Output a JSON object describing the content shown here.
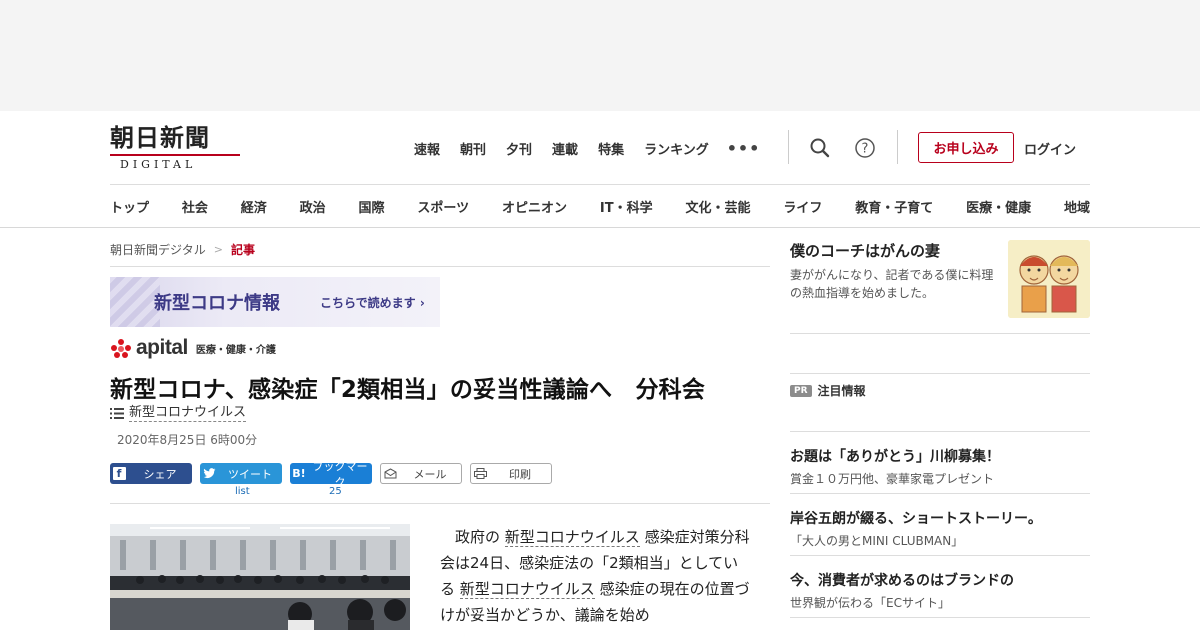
{
  "header": {
    "logo_main": "朝日新聞",
    "logo_sub": "DIGITAL",
    "top_nav": [
      "速報",
      "朝刊",
      "夕刊",
      "連載",
      "特集",
      "ランキング"
    ],
    "more_label": "•••",
    "subscribe_label": "お申し込み",
    "login_label": "ログイン",
    "help_label": "?"
  },
  "category_nav": [
    "トップ",
    "社会",
    "経済",
    "政治",
    "国際",
    "スポーツ",
    "オピニオン",
    "IT・科学",
    "文化・芸能",
    "ライフ",
    "教育・子育て",
    "医療・健康",
    "地域"
  ],
  "breadcrumb": {
    "home": "朝日新聞デジタル",
    "separator": ">",
    "current": "記事"
  },
  "banner": {
    "title": "新型コロナ情報",
    "link": "こちらで読めます ›"
  },
  "apital": {
    "word": "apital",
    "tagline": "医療・健康・介護"
  },
  "article": {
    "title": "新型コロナ、感染症「2類相当」の妥当性議論へ　分科会",
    "topic": "新型コロナウイルス",
    "date": "2020年8月25日 6時00分",
    "body": {
      "p1_a": "　政府の",
      "kw1": "新型コロナウイルス",
      "p1_b": "感染症対策分科会は24日、感染症法の「2類相当」としている",
      "kw2": "新型コロナウイルス",
      "p1_c": "感染症の現在の位置づけが妥当かどうか、議論を始め"
    }
  },
  "share": {
    "facebook": {
      "icon": "f",
      "label": "シェア"
    },
    "twitter": {
      "icon": "t",
      "label": "ツイート",
      "count": "list"
    },
    "hatena": {
      "icon": "B!",
      "label": "ブックマーク",
      "count": "25"
    },
    "mail": {
      "label": "メール"
    },
    "print": {
      "label": "印刷"
    }
  },
  "sidebar": {
    "feature": {
      "title": "僕のコーチはがんの妻",
      "desc": "妻ががんになり、記者である僕に料理の熱血指導を始めました。"
    },
    "pr_badge": "PR",
    "pr_title": "注目情報",
    "pr_items": [
      {
        "title": "お題は「ありがとう」川柳募集！",
        "desc": "賞金１０万円他、豪華家電プレゼント"
      },
      {
        "title": "岸谷五朗が綴る、ショートストーリー。",
        "desc": "「大人の男とMINI CLUBMAN」"
      },
      {
        "title": "今、消費者が求めるのはブランドの",
        "desc": "世界観が伝わる「ECサイト」"
      }
    ]
  },
  "colors": {
    "brand_red": "#b8001c",
    "facebook": "#2d4f8f",
    "twitter": "#2a95d8",
    "hatena": "#1a7fd6",
    "corona_banner_text": "#3d3a86",
    "apital_red": "#d9141e"
  }
}
